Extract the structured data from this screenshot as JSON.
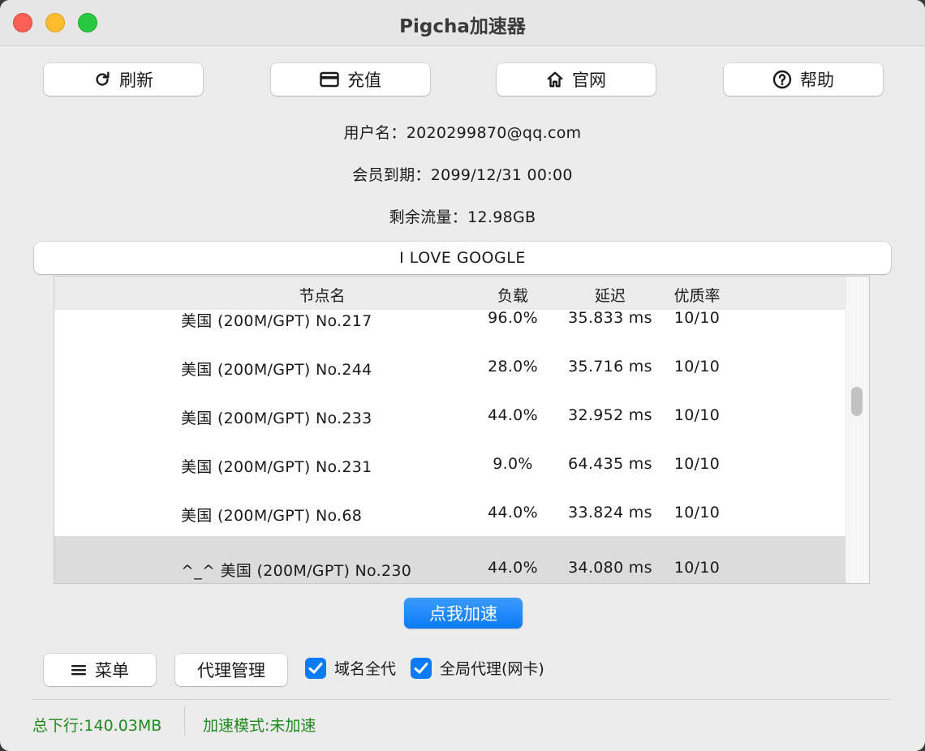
{
  "window": {
    "title": "Pigcha加速器"
  },
  "toolbar": {
    "refresh_label": "刷新",
    "recharge_label": "充值",
    "website_label": "官网",
    "help_label": "帮助"
  },
  "account": {
    "username": "用户名：2020299870@qq.com",
    "expiry": "会员到期：2099/12/31 00:00",
    "traffic": "剩余流量：12.98GB"
  },
  "banner": {
    "text": "I LOVE GOOGLE"
  },
  "table": {
    "headers": {
      "name": "节点名",
      "load": "负载",
      "latency": "延迟",
      "quality": "优质率"
    },
    "rows": [
      {
        "name": "美国 (200M/GPT) No.217",
        "load": "96.0%",
        "latency": "35.833 ms",
        "quality": "10/10"
      },
      {
        "name": "美国 (200M/GPT) No.244",
        "load": "28.0%",
        "latency": "35.716 ms",
        "quality": "10/10"
      },
      {
        "name": "美国 (200M/GPT) No.233",
        "load": "44.0%",
        "latency": "32.952 ms",
        "quality": "10/10"
      },
      {
        "name": "美国 (200M/GPT) No.231",
        "load": "9.0%",
        "latency": "64.435 ms",
        "quality": "10/10"
      },
      {
        "name": "美国 (200M/GPT) No.68",
        "load": "44.0%",
        "latency": "33.824 ms",
        "quality": "10/10"
      },
      {
        "name": "^_^ 美国 (200M/GPT) No.230",
        "load": "44.0%",
        "latency": "34.080 ms",
        "quality": "10/10"
      }
    ]
  },
  "actions": {
    "accelerate_label": "点我加速"
  },
  "bottom": {
    "menu_label": "菜单",
    "proxy_manage_label": "代理管理",
    "domain_proxy_label": "域名全代",
    "domain_proxy_checked": true,
    "global_proxy_label": "全局代理(网卡)",
    "global_proxy_checked": true
  },
  "status": {
    "total_download": "总下行:140.03MB",
    "mode": "加速模式:未加速"
  },
  "colors": {
    "accent": "#0a7bf6",
    "status_green": "#1e8a1e",
    "selected_row": "#dcdcdc"
  }
}
